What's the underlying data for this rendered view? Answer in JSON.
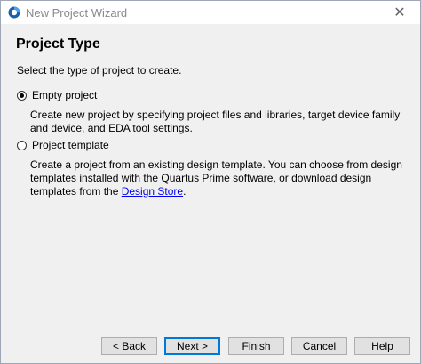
{
  "window": {
    "title": "New Project Wizard",
    "close_glyph": "✕",
    "app_icon": "quartus-logo-icon"
  },
  "header": {
    "title": "Project Type"
  },
  "main": {
    "instruction": "Select the type of project to create.",
    "options": [
      {
        "label": "Empty project",
        "selected": true,
        "description": "Create new project by specifying project files and libraries, target device family and device, and EDA tool settings."
      },
      {
        "label": "Project template",
        "selected": false,
        "description_prefix": "Create a project from an existing design template. You can choose from design templates installed with the Quartus Prime software, or download design templates from the ",
        "link_text": "Design Store",
        "description_suffix": "."
      }
    ]
  },
  "buttons": {
    "back": "< Back",
    "next": "Next >",
    "finish": "Finish",
    "cancel": "Cancel",
    "help": "Help"
  }
}
